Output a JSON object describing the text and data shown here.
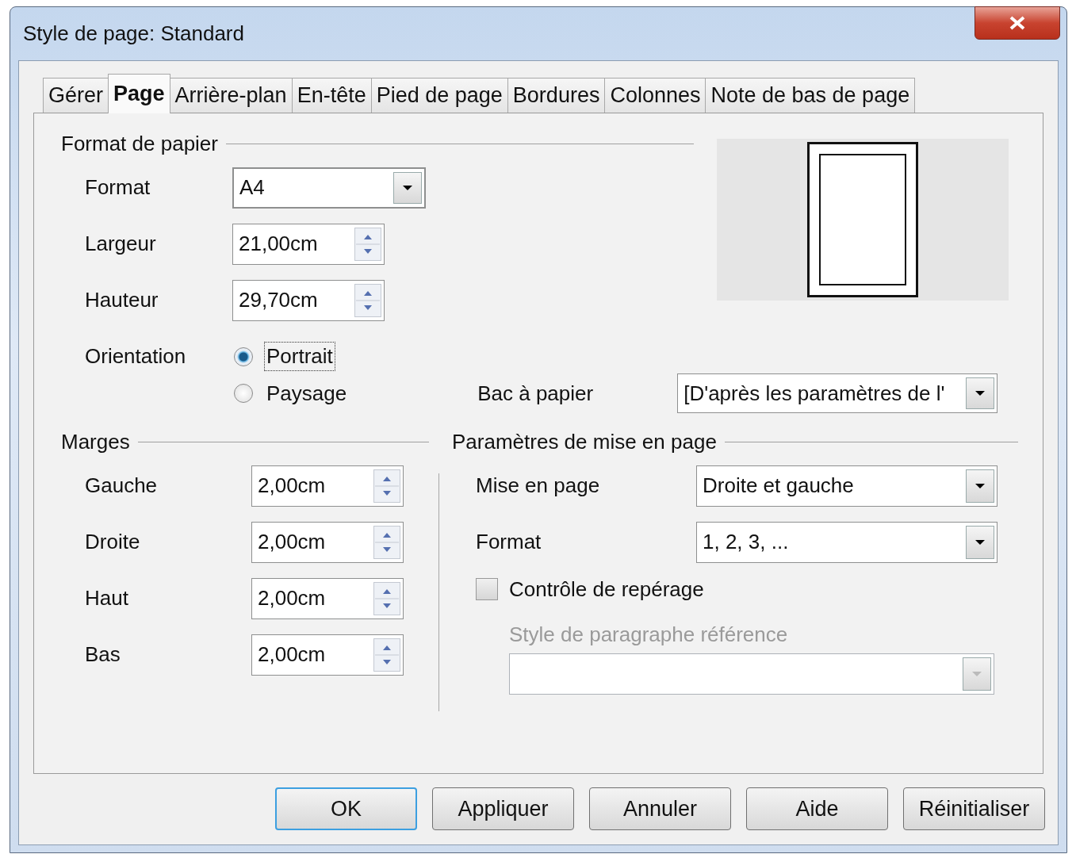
{
  "window": {
    "title": "Style de page: Standard"
  },
  "tabs": [
    {
      "label": "Gérer",
      "selected": false
    },
    {
      "label": "Page",
      "selected": true
    },
    {
      "label": "Arrière-plan",
      "selected": false
    },
    {
      "label": "En-tête",
      "selected": false
    },
    {
      "label": "Pied de page",
      "selected": false
    },
    {
      "label": "Bordures",
      "selected": false
    },
    {
      "label": "Colonnes",
      "selected": false
    },
    {
      "label": "Note de bas de page",
      "selected": false
    }
  ],
  "paper_format": {
    "heading": "Format de papier",
    "format": {
      "label": "Format",
      "value": "A4"
    },
    "width": {
      "label": "Largeur",
      "value": "21,00cm"
    },
    "height": {
      "label": "Hauteur",
      "value": "29,70cm"
    },
    "orientation": {
      "label": "Orientation",
      "options": [
        {
          "label": "Portrait",
          "selected": true
        },
        {
          "label": "Paysage",
          "selected": false
        }
      ]
    },
    "paper_tray": {
      "label": "Bac à papier",
      "value": "[D'après les paramètres de l'"
    }
  },
  "margins": {
    "heading": "Marges",
    "fields": [
      {
        "label": "Gauche",
        "value": "2,00cm"
      },
      {
        "label": "Droite",
        "value": "2,00cm"
      },
      {
        "label": "Haut",
        "value": "2,00cm"
      },
      {
        "label": "Bas",
        "value": "2,00cm"
      }
    ]
  },
  "layout_settings": {
    "heading": "Paramètres de mise en page",
    "page_layout": {
      "label": "Mise en page",
      "value": "Droite et gauche"
    },
    "format": {
      "label": "Format",
      "value": "1, 2, 3, ..."
    },
    "register_true": {
      "label": "Contrôle de repérage",
      "checked": false
    },
    "reference_style": {
      "label": "Style de paragraphe référence",
      "disabled": true
    }
  },
  "buttons": [
    {
      "label": "OK",
      "default": true
    },
    {
      "label": "Appliquer",
      "default": false
    },
    {
      "label": "Annuler",
      "default": false
    },
    {
      "label": "Aide",
      "default": false
    },
    {
      "label": "Réinitialiser",
      "default": false
    }
  ]
}
